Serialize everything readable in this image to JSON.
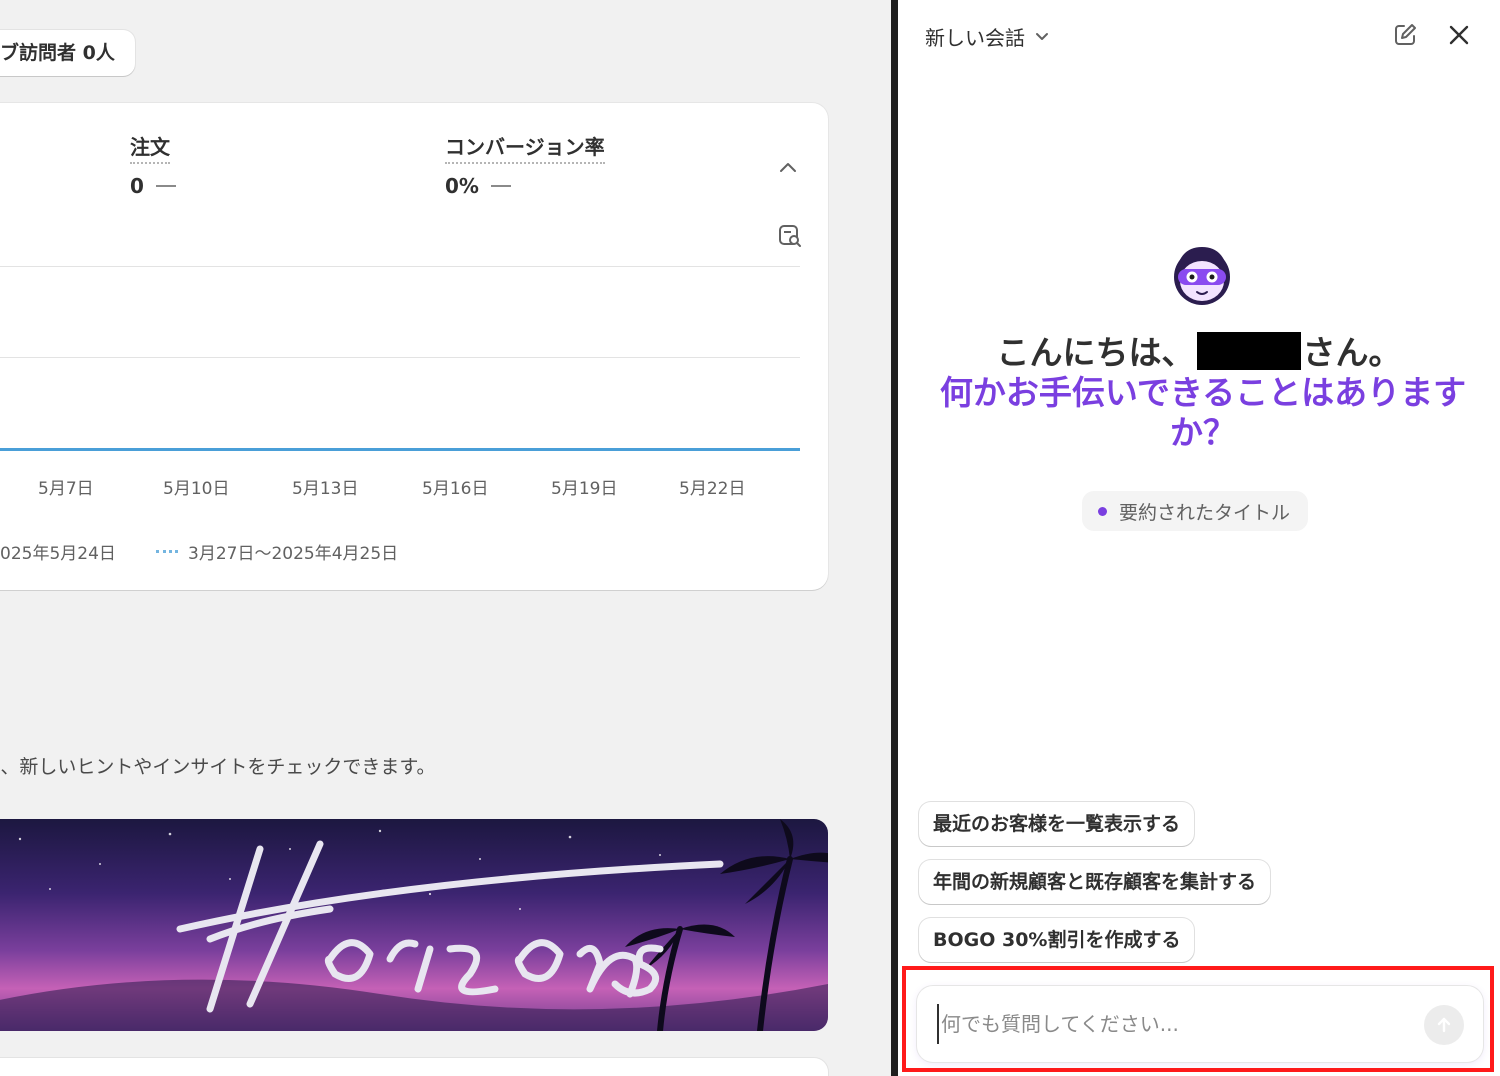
{
  "left": {
    "visitor_pill": "ブ訪問者 0人",
    "metrics": [
      {
        "label": "注文",
        "value": "0"
      },
      {
        "label": "コンバージョン率",
        "value": "0%"
      }
    ],
    "chart_data": {
      "type": "line",
      "x": [
        "5月7日",
        "5月10日",
        "5月13日",
        "5月16日",
        "5月19日",
        "5月22日"
      ],
      "series": [
        {
          "values": [
            0,
            0,
            0,
            0,
            0,
            0
          ]
        }
      ],
      "legend": [
        "025年5月24日",
        "3月27日〜2025年4月25日"
      ],
      "grid": true
    },
    "hint_text": "に、新しいヒントやインサイトをチェックできます。"
  },
  "right": {
    "header_title": "新しい会話",
    "greeting_prefix": "こんにちは、",
    "greeting_suffix": "さん。",
    "greeting_sub": "何かお手伝いできることはありますか？",
    "summary_pill": "要約されたタイトル",
    "suggestions": [
      "最近のお客様を一覧表示する",
      "年間の新規顧客と既存顧客を集計する",
      "BOGO 30%割引を作成する"
    ],
    "input_placeholder": "何でも質問してください..."
  },
  "colors": {
    "accent_purple": "#7a3fe0",
    "chart_line": "#4a9fd8",
    "highlight_red": "#ff1a1a"
  }
}
